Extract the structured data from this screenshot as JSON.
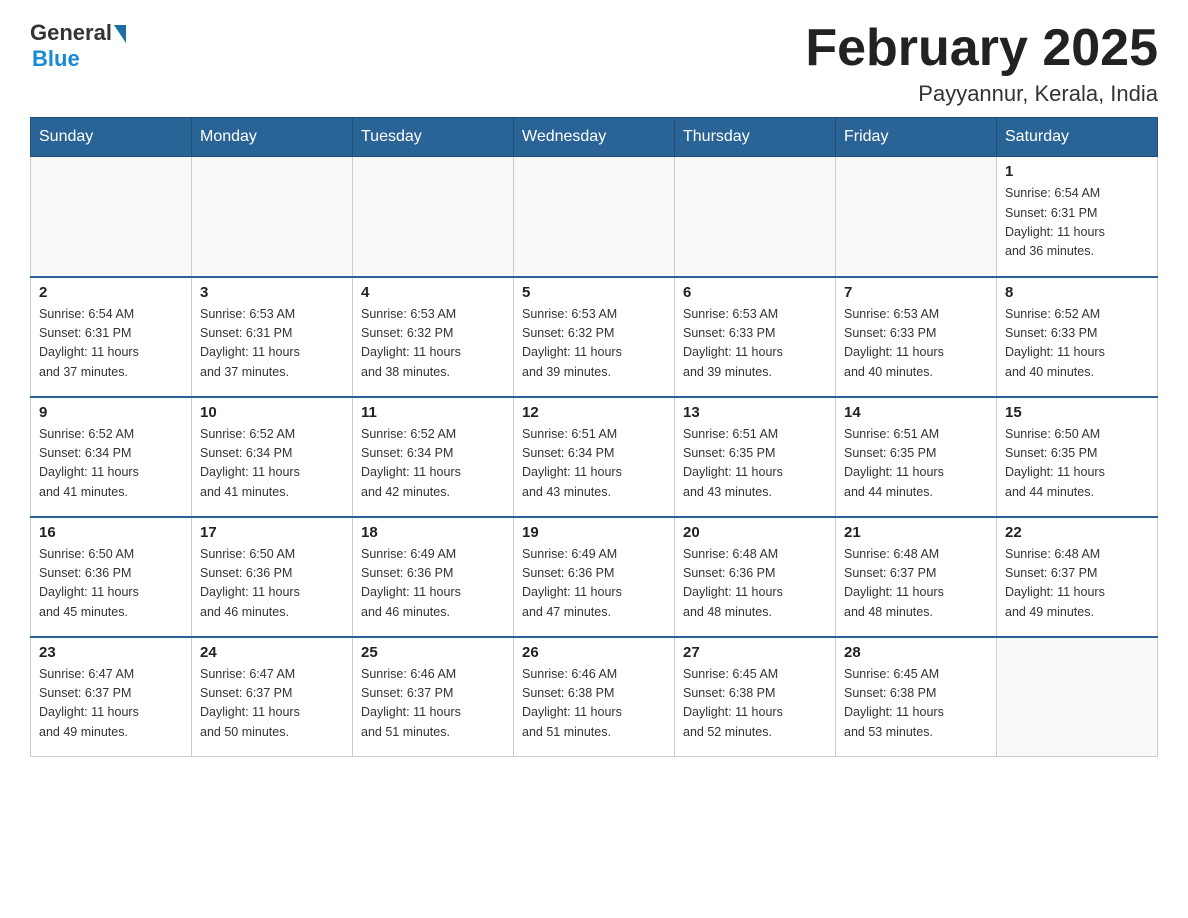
{
  "header": {
    "logo_general": "General",
    "logo_blue": "Blue",
    "month_title": "February 2025",
    "location": "Payyannur, Kerala, India"
  },
  "weekdays": [
    "Sunday",
    "Monday",
    "Tuesday",
    "Wednesday",
    "Thursday",
    "Friday",
    "Saturday"
  ],
  "weeks": [
    [
      {
        "num": "",
        "info": ""
      },
      {
        "num": "",
        "info": ""
      },
      {
        "num": "",
        "info": ""
      },
      {
        "num": "",
        "info": ""
      },
      {
        "num": "",
        "info": ""
      },
      {
        "num": "",
        "info": ""
      },
      {
        "num": "1",
        "info": "Sunrise: 6:54 AM\nSunset: 6:31 PM\nDaylight: 11 hours\nand 36 minutes."
      }
    ],
    [
      {
        "num": "2",
        "info": "Sunrise: 6:54 AM\nSunset: 6:31 PM\nDaylight: 11 hours\nand 37 minutes."
      },
      {
        "num": "3",
        "info": "Sunrise: 6:53 AM\nSunset: 6:31 PM\nDaylight: 11 hours\nand 37 minutes."
      },
      {
        "num": "4",
        "info": "Sunrise: 6:53 AM\nSunset: 6:32 PM\nDaylight: 11 hours\nand 38 minutes."
      },
      {
        "num": "5",
        "info": "Sunrise: 6:53 AM\nSunset: 6:32 PM\nDaylight: 11 hours\nand 39 minutes."
      },
      {
        "num": "6",
        "info": "Sunrise: 6:53 AM\nSunset: 6:33 PM\nDaylight: 11 hours\nand 39 minutes."
      },
      {
        "num": "7",
        "info": "Sunrise: 6:53 AM\nSunset: 6:33 PM\nDaylight: 11 hours\nand 40 minutes."
      },
      {
        "num": "8",
        "info": "Sunrise: 6:52 AM\nSunset: 6:33 PM\nDaylight: 11 hours\nand 40 minutes."
      }
    ],
    [
      {
        "num": "9",
        "info": "Sunrise: 6:52 AM\nSunset: 6:34 PM\nDaylight: 11 hours\nand 41 minutes."
      },
      {
        "num": "10",
        "info": "Sunrise: 6:52 AM\nSunset: 6:34 PM\nDaylight: 11 hours\nand 41 minutes."
      },
      {
        "num": "11",
        "info": "Sunrise: 6:52 AM\nSunset: 6:34 PM\nDaylight: 11 hours\nand 42 minutes."
      },
      {
        "num": "12",
        "info": "Sunrise: 6:51 AM\nSunset: 6:34 PM\nDaylight: 11 hours\nand 43 minutes."
      },
      {
        "num": "13",
        "info": "Sunrise: 6:51 AM\nSunset: 6:35 PM\nDaylight: 11 hours\nand 43 minutes."
      },
      {
        "num": "14",
        "info": "Sunrise: 6:51 AM\nSunset: 6:35 PM\nDaylight: 11 hours\nand 44 minutes."
      },
      {
        "num": "15",
        "info": "Sunrise: 6:50 AM\nSunset: 6:35 PM\nDaylight: 11 hours\nand 44 minutes."
      }
    ],
    [
      {
        "num": "16",
        "info": "Sunrise: 6:50 AM\nSunset: 6:36 PM\nDaylight: 11 hours\nand 45 minutes."
      },
      {
        "num": "17",
        "info": "Sunrise: 6:50 AM\nSunset: 6:36 PM\nDaylight: 11 hours\nand 46 minutes."
      },
      {
        "num": "18",
        "info": "Sunrise: 6:49 AM\nSunset: 6:36 PM\nDaylight: 11 hours\nand 46 minutes."
      },
      {
        "num": "19",
        "info": "Sunrise: 6:49 AM\nSunset: 6:36 PM\nDaylight: 11 hours\nand 47 minutes."
      },
      {
        "num": "20",
        "info": "Sunrise: 6:48 AM\nSunset: 6:36 PM\nDaylight: 11 hours\nand 48 minutes."
      },
      {
        "num": "21",
        "info": "Sunrise: 6:48 AM\nSunset: 6:37 PM\nDaylight: 11 hours\nand 48 minutes."
      },
      {
        "num": "22",
        "info": "Sunrise: 6:48 AM\nSunset: 6:37 PM\nDaylight: 11 hours\nand 49 minutes."
      }
    ],
    [
      {
        "num": "23",
        "info": "Sunrise: 6:47 AM\nSunset: 6:37 PM\nDaylight: 11 hours\nand 49 minutes."
      },
      {
        "num": "24",
        "info": "Sunrise: 6:47 AM\nSunset: 6:37 PM\nDaylight: 11 hours\nand 50 minutes."
      },
      {
        "num": "25",
        "info": "Sunrise: 6:46 AM\nSunset: 6:37 PM\nDaylight: 11 hours\nand 51 minutes."
      },
      {
        "num": "26",
        "info": "Sunrise: 6:46 AM\nSunset: 6:38 PM\nDaylight: 11 hours\nand 51 minutes."
      },
      {
        "num": "27",
        "info": "Sunrise: 6:45 AM\nSunset: 6:38 PM\nDaylight: 11 hours\nand 52 minutes."
      },
      {
        "num": "28",
        "info": "Sunrise: 6:45 AM\nSunset: 6:38 PM\nDaylight: 11 hours\nand 53 minutes."
      },
      {
        "num": "",
        "info": ""
      }
    ]
  ]
}
